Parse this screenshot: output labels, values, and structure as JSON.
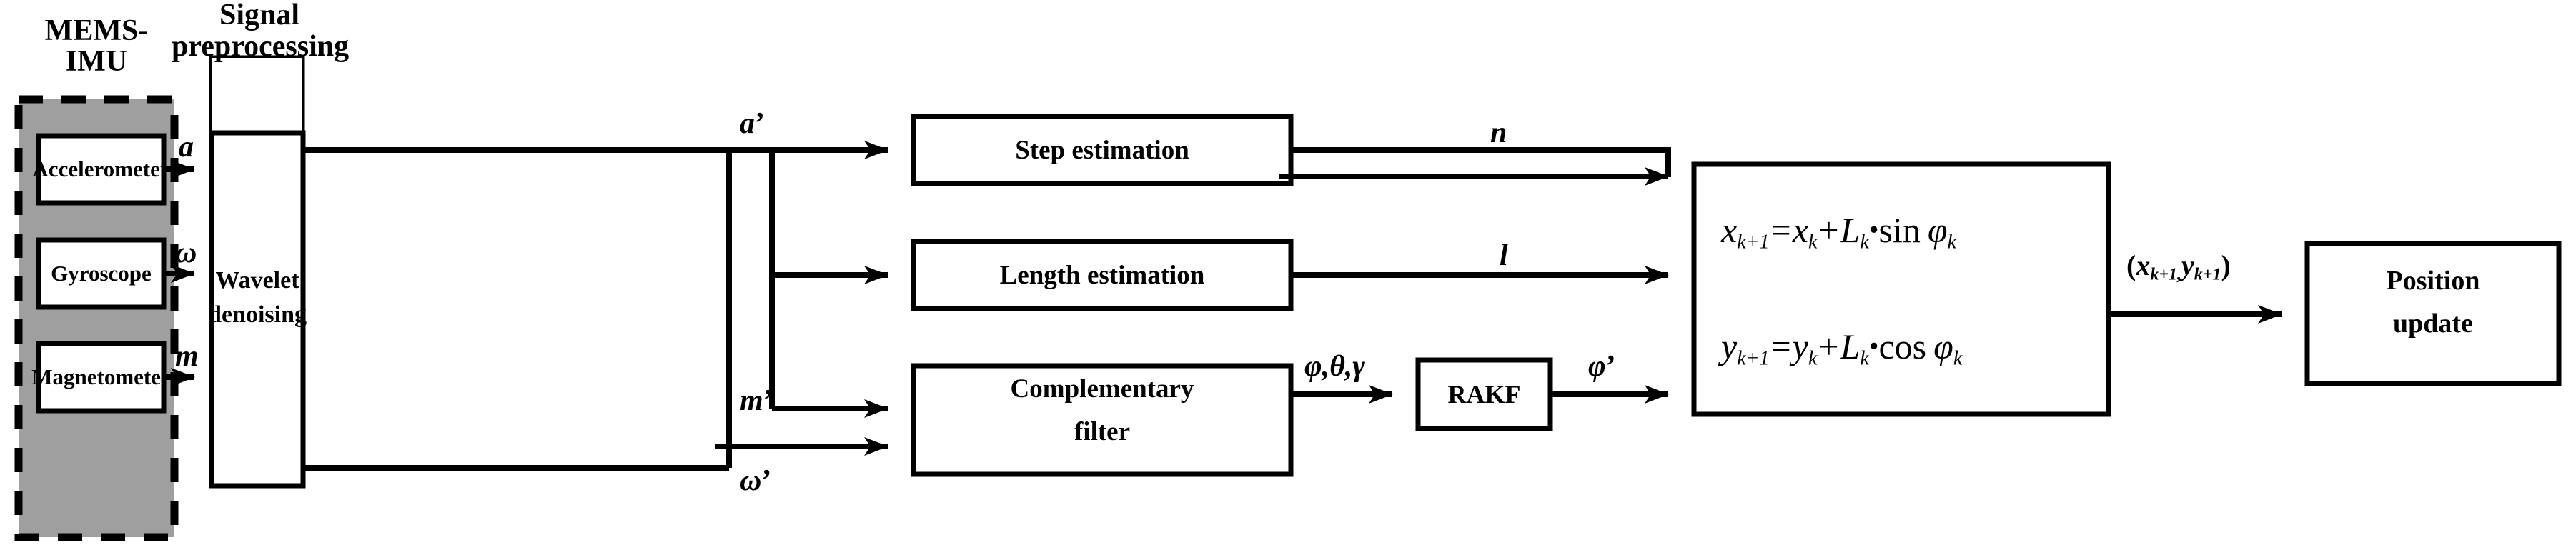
{
  "diagram": {
    "title_groups": {
      "mems_imu": "MEMS-IMU",
      "signal_preprocessing_line1": "Signal",
      "signal_preprocessing_line2": "preprocessing"
    },
    "blocks": {
      "accelerometer": "Accelerometer",
      "gyroscope": "Gyroscope",
      "magnetometer": "Magnetometer",
      "wavelet_line1": "Wavelet",
      "wavelet_line2": "denoising",
      "step_estimation": "Step estimation",
      "length_estimation": "Length estimation",
      "complementary_line1": "Complementary",
      "complementary_line2": "filter",
      "rakf": "RAKF",
      "position_update_line1": "Position",
      "position_update_line2": "update"
    },
    "signals": {
      "a": "a",
      "omega": "ω",
      "m": "m",
      "a_prime_base": "a",
      "m_prime_base": "m",
      "omega_prime_base": "ω",
      "prime": "’",
      "n": "n",
      "l": "l",
      "phi_theta_gamma": "φ,θ,γ",
      "phi_prime_base": "φ"
    },
    "equations": {
      "eq1": {
        "lhs_var": "x",
        "lhs_sub": "k+1",
        "eq": "=",
        "t1_var": "x",
        "t1_sub": "k",
        "plus": "+",
        "t2_var": "L",
        "t2_sub": "k",
        "bullet": "•",
        "fn": "sin",
        "angle_var": "φ",
        "angle_sub": "k",
        "plain": "x(k+1) = x(k) + L(k)•sin φ(k)"
      },
      "eq2": {
        "lhs_var": "y",
        "lhs_sub": "k+1",
        "eq": "=",
        "t1_var": "y",
        "t1_sub": "k",
        "plus": "+",
        "t2_var": "L",
        "t2_sub": "k",
        "bullet": "•",
        "fn": "cos",
        "angle_var": "φ",
        "angle_sub": "k",
        "plain": "y(k+1) = y(k) + L(k)•cos φ(k)"
      }
    },
    "coordinate_output": {
      "open": "(",
      "x_var": "x",
      "x_sub": "k+1,",
      "y_var": "y",
      "y_sub": "k+1",
      "close": ")",
      "plain": "(x(k+1), y(k+1))"
    },
    "colors": {
      "line": "#000000",
      "fill_panel": "#9f9f9f",
      "fill_block": "#ffffff",
      "background": "#ffffff"
    }
  }
}
